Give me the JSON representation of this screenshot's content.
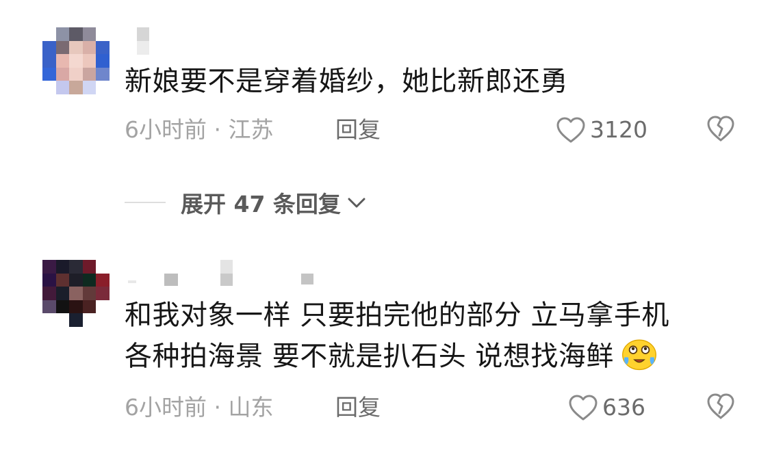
{
  "comments": [
    {
      "text_lines": [
        "新娘要不是穿着婚纱，她比新郎还勇"
      ],
      "time_location": "6小时前 · 江苏",
      "reply_label": "回复",
      "likes": "3120",
      "emoji": null
    },
    {
      "text_lines": [
        "和我对象一样 只要拍完他的部分 立马拿手机",
        "各种拍海景 要不就是扒石头 说想找海鲜"
      ],
      "time_location": "6小时前 · 山东",
      "reply_label": "回复",
      "likes": "636",
      "emoji": "crying-laughing-emoji"
    }
  ],
  "expand_replies": {
    "label": "展开 47 条回复"
  },
  "icons": {
    "like": "heart-outline-icon",
    "dislike": "broken-heart-icon",
    "expand": "chevron-down-icon"
  },
  "colors": {
    "text_primary": "#161616",
    "text_muted": "#a3a3a3",
    "text_secondary": "#6b6b6b"
  }
}
